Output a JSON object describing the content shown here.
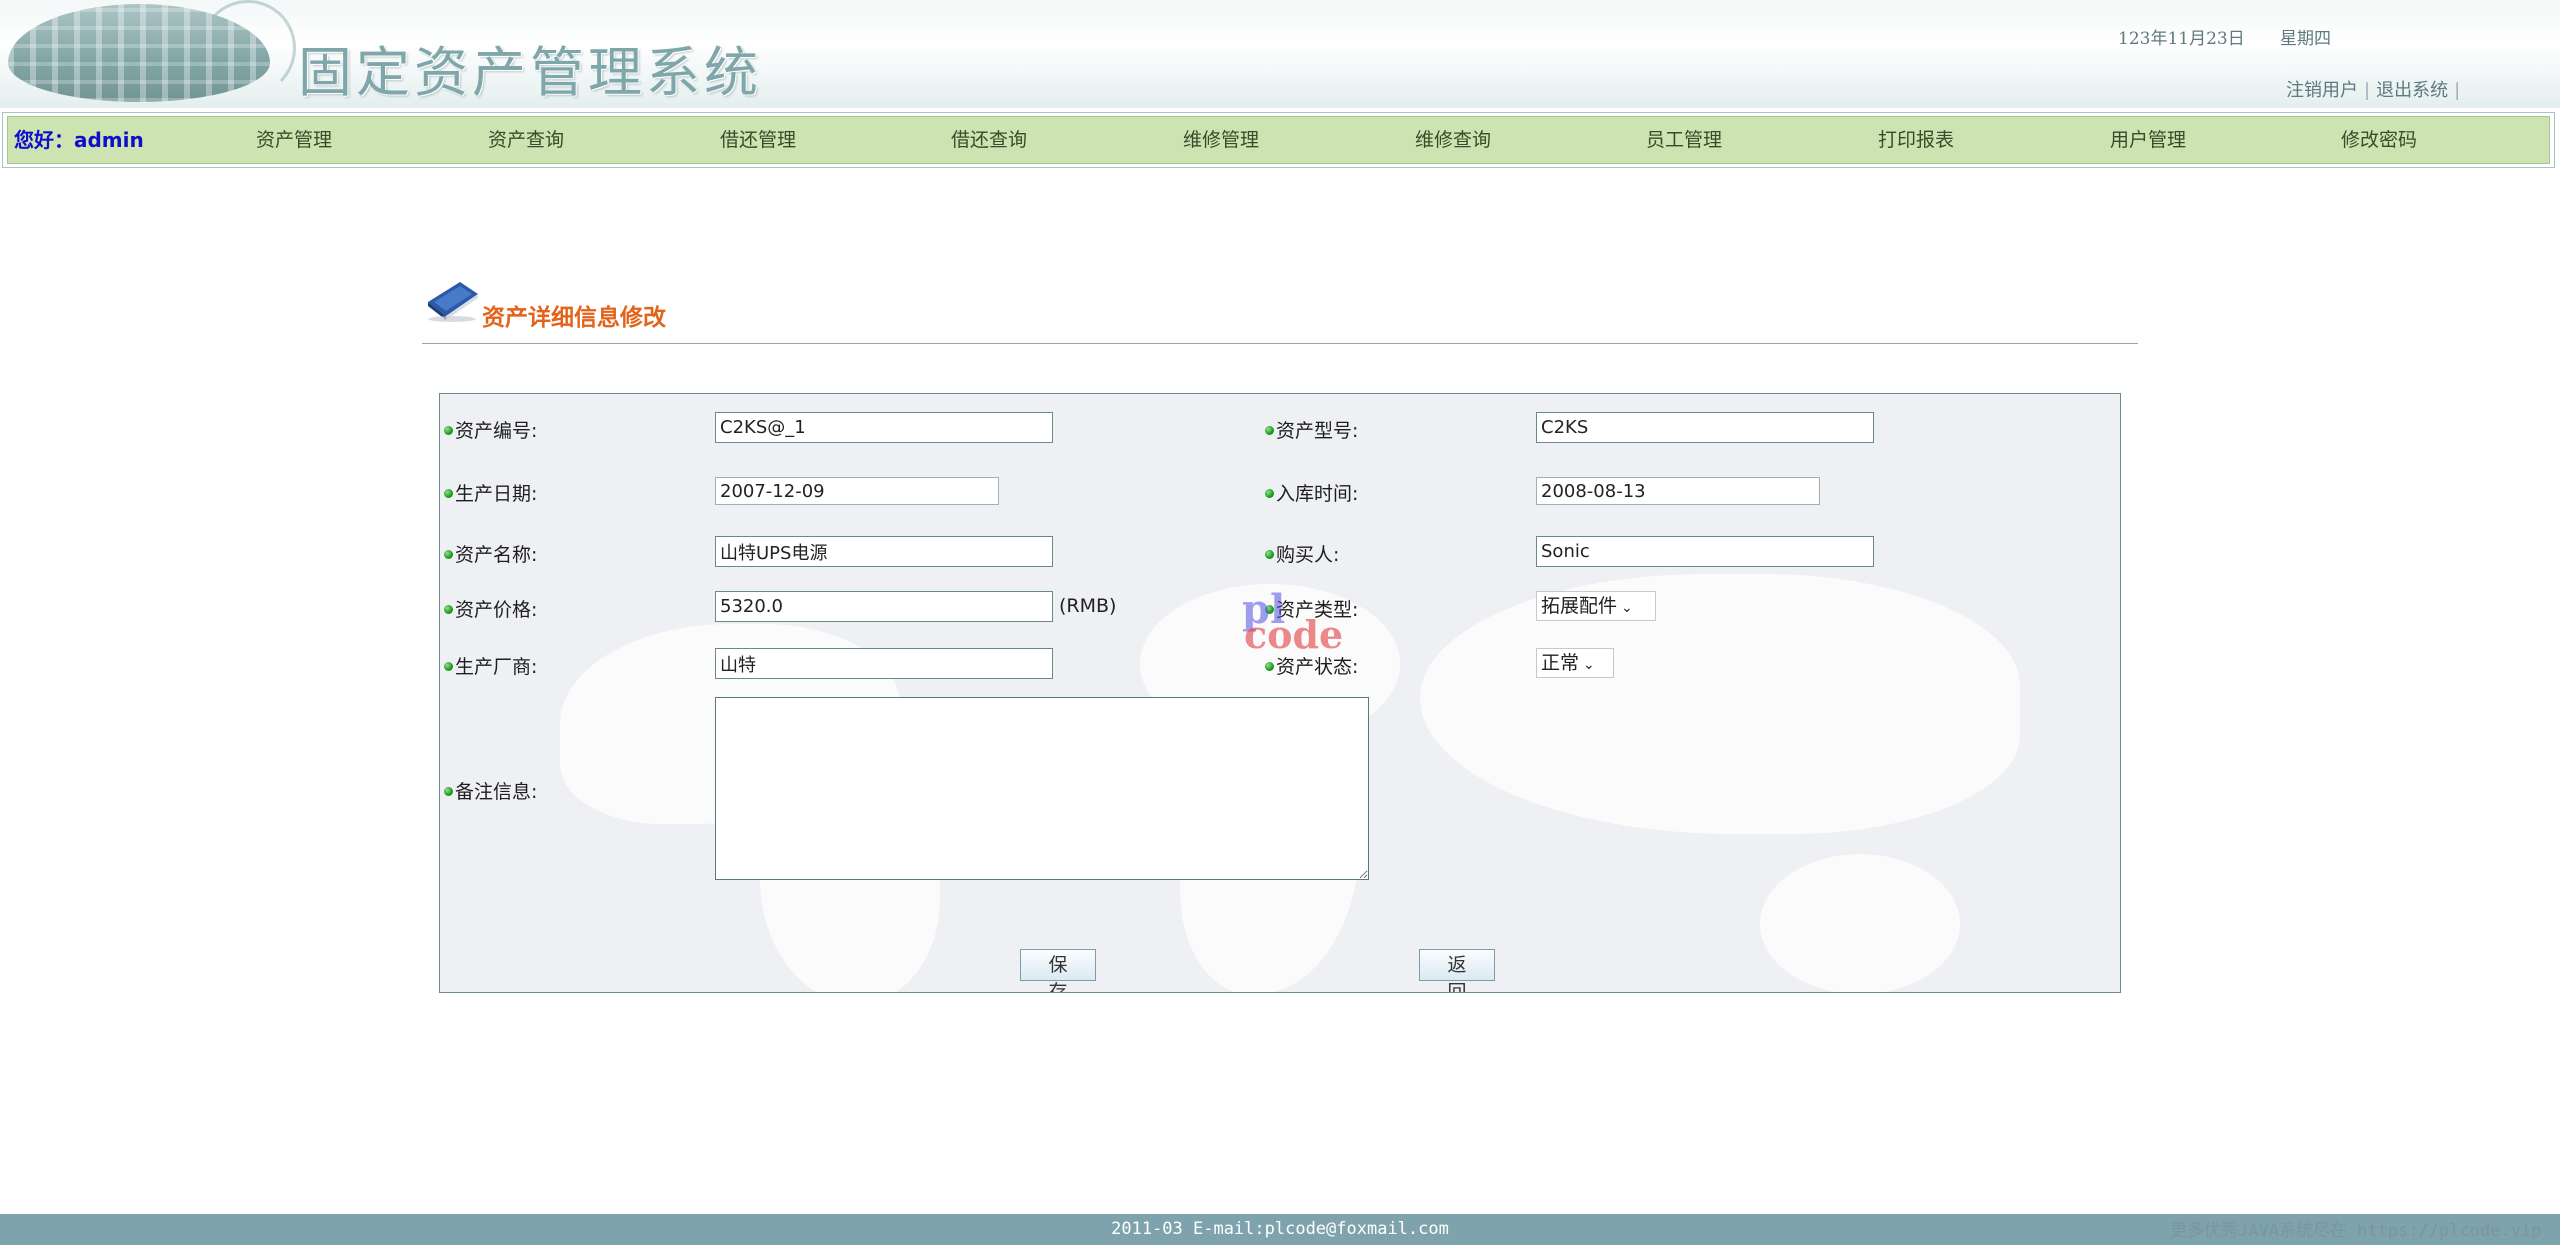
{
  "header": {
    "system_title": "固定资产管理系统",
    "date": "123年11月23日",
    "weekday": "星期四",
    "logout_user": "注销用户",
    "separator": "|",
    "exit_system": "退出系统"
  },
  "nav": {
    "greeting": "您好：admin",
    "items": [
      "资产管理",
      "资产查询",
      "借还管理",
      "借还查询",
      "维修管理",
      "维修查询",
      "员工管理",
      "打印报表",
      "用户管理",
      "修改密码"
    ]
  },
  "page": {
    "title": "资产详细信息修改",
    "icon": "book-icon"
  },
  "form": {
    "asset_no_label": "资产编号:",
    "asset_no": "C2KS@_1",
    "model_label": "资产型号:",
    "model": "C2KS",
    "prod_date_label": "生产日期:",
    "prod_date": "2007-12-09",
    "stock_date_label": "入库时间:",
    "stock_date": "2008-08-13",
    "name_label": "资产名称:",
    "name": "山特UPS电源",
    "buyer_label": "购买人:",
    "buyer": "Sonic",
    "price_label": "资产价格:",
    "price": "5320.0",
    "price_unit": "(RMB)",
    "type_label": "资产类型:",
    "type_selected": "拓展配件",
    "maker_label": "生产厂商:",
    "maker": "山特",
    "status_label": "资产状态:",
    "status_selected": "正常",
    "remark_label": "备注信息:",
    "remark": "",
    "save_label": "保 存",
    "back_label": "返 回"
  },
  "watermark": {
    "line1": "pl",
    "line2": "code"
  },
  "footer": {
    "text": "2011-03 E-mail:plcode@foxmail.com",
    "right_text": "更多优秀JAVA系统尽在 https://plcode.vip"
  },
  "colors": {
    "nav_bg": "#cde3b2",
    "greeting": "#1010c8",
    "title": "#e4631a",
    "footer_bg": "#7ea3ad"
  }
}
